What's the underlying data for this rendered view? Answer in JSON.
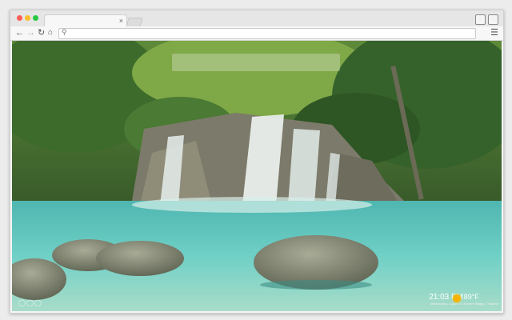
{
  "browser": {
    "tab_close": "×",
    "nav": {
      "back": "←",
      "forward": "→",
      "reload": "↻",
      "home": "⌂"
    },
    "omnibox_icon": "search-icon",
    "menu_icon": "☰"
  },
  "newtab": {
    "apps_label": "◯◯◯",
    "clock": {
      "time": "21:03 PM",
      "date": "Wednesday, August 12"
    },
    "weather": {
      "temp": "89°F",
      "desc": "Shreve Village, Thailand",
      "icon": "sun-icon"
    }
  },
  "colors": {
    "water": "#5fc4bd",
    "foliage": "#2f5a2a",
    "accent_sun": "#f5b400"
  }
}
